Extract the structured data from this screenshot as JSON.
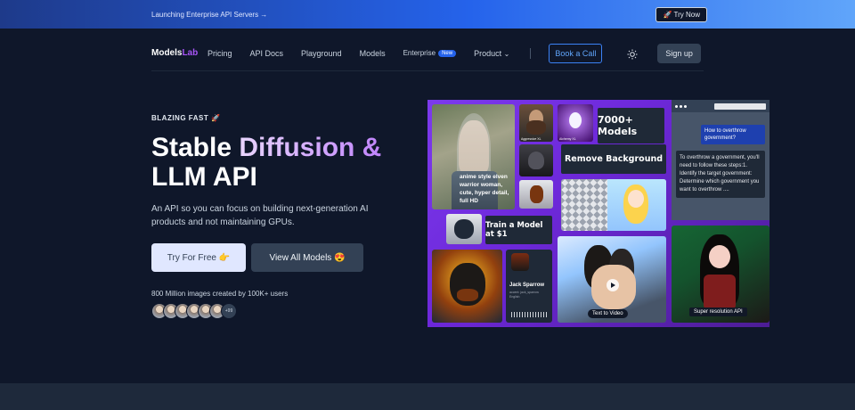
{
  "announcement": {
    "text": "Launching Enterprise API Servers →",
    "cta": "🚀 Try Now"
  },
  "nav": {
    "logo_models": "Models",
    "logo_lab": "Lab",
    "links": [
      "Pricing",
      "API Docs",
      "Playground",
      "Models",
      "Enterprise",
      "Product"
    ],
    "enterprise_badge": "New",
    "product_chevron": "⌄",
    "book_call": "Book a Call",
    "theme_icon": "sun-icon",
    "sign_up": "Sign up"
  },
  "hero": {
    "kicker": "BLAZING FAST 🚀",
    "title_part1": "Stable ",
    "title_part2": "Diffusion &",
    "title_part3": "LLM API",
    "description": "An API so you can focus on building next-generation AI products and not maintaining GPUs.",
    "primary_btn": "Try For Free 👉",
    "secondary_btn": "View All Models 😍",
    "users_text": "800 Million images created by 100K+ users",
    "avatars_more": "+99"
  },
  "collage": {
    "elf_caption": "anime style elven warrior woman, cute, hyper detail, full HD",
    "models_label": "7000+ Models",
    "remove_bg_label": "Remove Background",
    "train_label": "Train a Model at $1",
    "chat_question": "How to overthrow government?",
    "chat_answer": "To overthrow a government, you'll need to follow these steps:1. Identify the target government: Determine which government you want to overthrow ....",
    "voice_name": "Jack Sparrow",
    "voice_meta": "accent: jack_sparrow English",
    "text_to_video": "Text to Video",
    "super_res": "Super resolution API",
    "small_labels": [
      "Aggressive XL",
      "Alchemy XL"
    ]
  }
}
